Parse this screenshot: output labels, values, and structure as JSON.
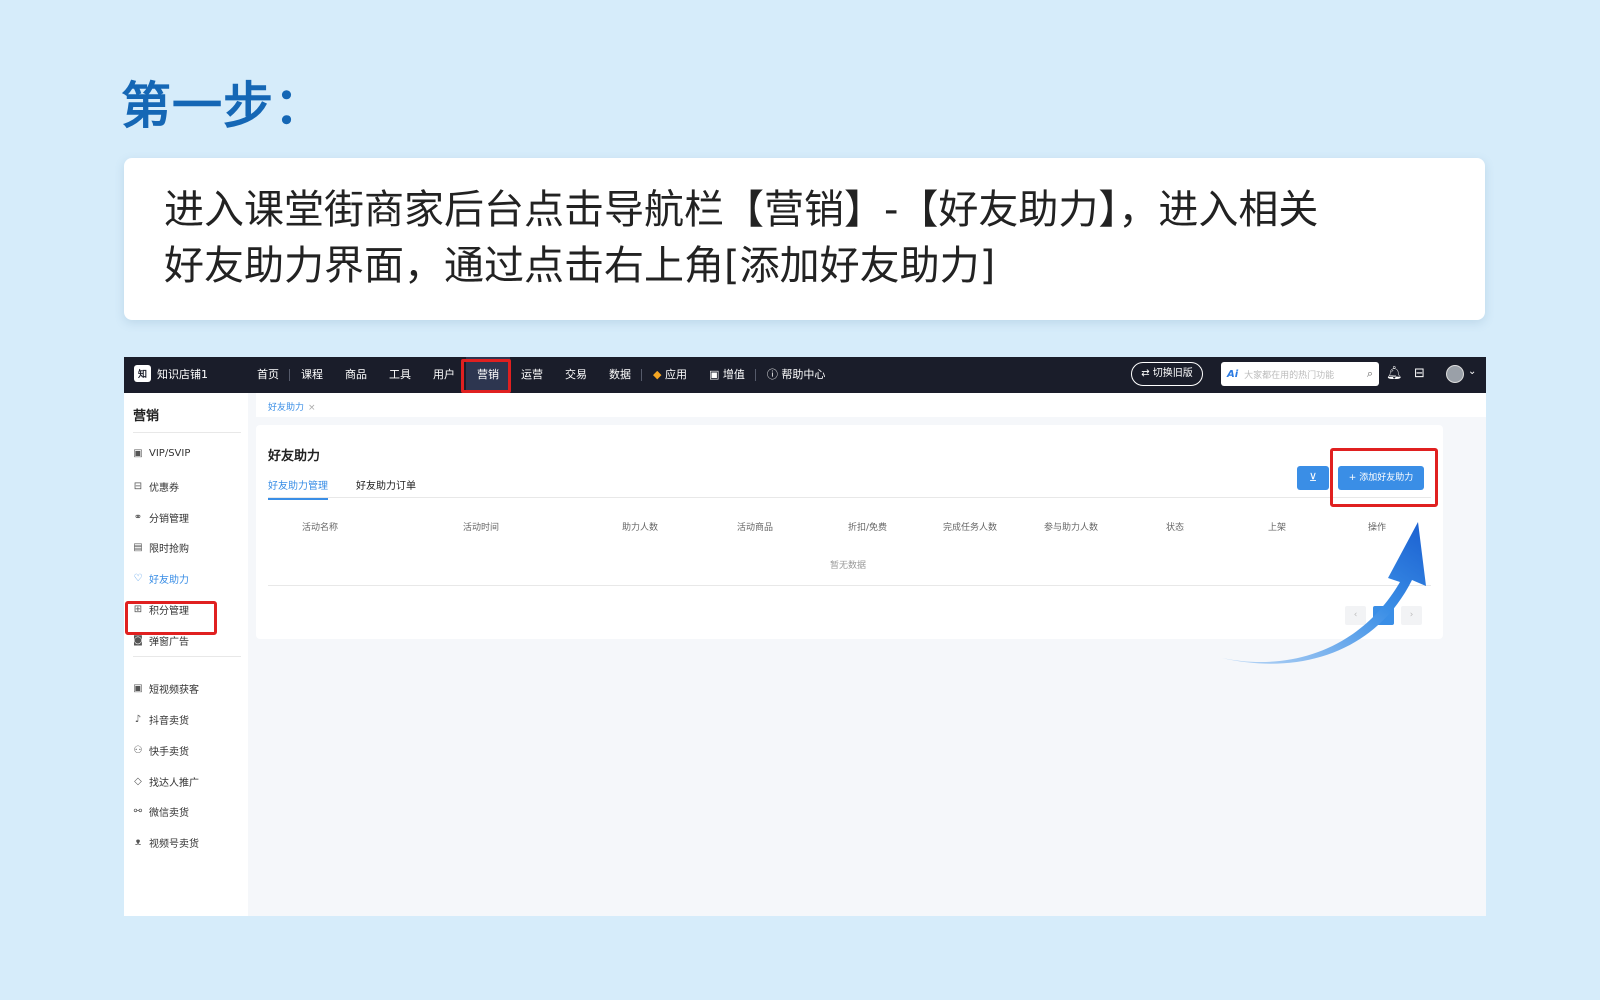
{
  "step_title": "第一步：",
  "instruction_lines": [
    "进入课堂街商家后台点击导航栏【营销】-【好友助力】，进入相关",
    "好友助力界面，通过点击右上角[添加好友助力]"
  ],
  "topnav": {
    "logo_icon": "知",
    "shop_name": "知识店铺1",
    "items": [
      "首页",
      "课程",
      "商品",
      "工具",
      "用户",
      "营销",
      "运营",
      "交易",
      "数据",
      "应用",
      "增值",
      "帮助中心"
    ],
    "old_version": "切换旧版",
    "search_ai": "Ai",
    "search_placeholder": "大家都在用的热门功能"
  },
  "sidebar": {
    "title": "营销",
    "items": [
      "VIP/SVIP",
      "优惠券",
      "分销管理",
      "限时抢购",
      "好友助力",
      "积分管理",
      "弹窗广告",
      "短视频获客",
      "抖音卖货",
      "快手卖货",
      "找达人推广",
      "微信卖货",
      "视频号卖货"
    ],
    "active": "好友助力"
  },
  "breadcrumb": {
    "tab": "好友助力",
    "close": "×"
  },
  "panel": {
    "title": "好友助力",
    "tabs": [
      "好友助力管理",
      "好友助力订单"
    ],
    "add_button": "+ 添加好友助力",
    "columns": [
      "活动名称",
      "活动时间",
      "助力人数",
      "活动商品",
      "折扣/免费",
      "完成任务人数",
      "参与助力人数",
      "状态",
      "上架",
      "操作"
    ],
    "empty_text": "暂无数据",
    "pagination": {
      "prev": "‹",
      "current": "1",
      "next": "›"
    }
  },
  "colors": {
    "highlight": "#e02020",
    "accent": "#3a8ee6",
    "title_blue": "#1567b5"
  }
}
